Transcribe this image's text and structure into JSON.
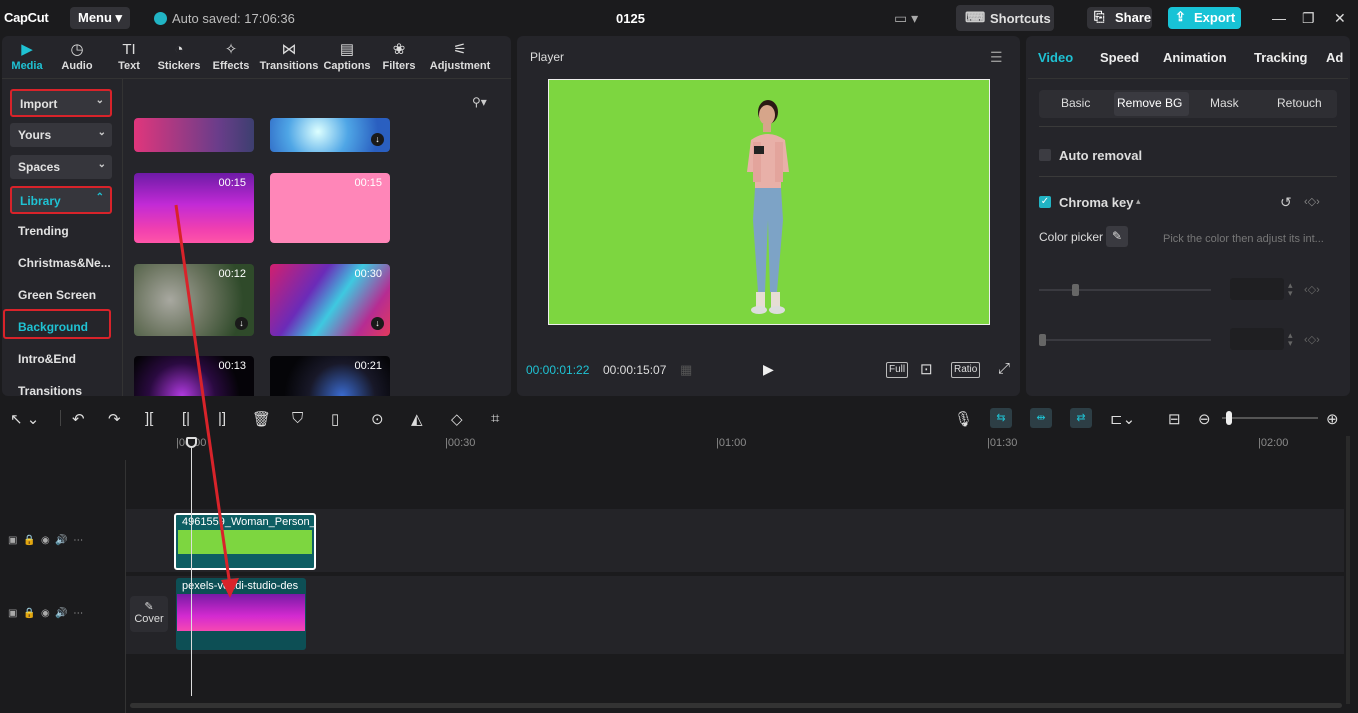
{
  "app": {
    "logo": "CapCut",
    "menu": "Menu ▾",
    "saved": "Auto saved: 17:06:36",
    "project": "0125",
    "shortcuts": "Shortcuts",
    "share": "Share",
    "export": "Export"
  },
  "tabs": [
    {
      "label": "Media",
      "icon": "▶"
    },
    {
      "label": "Audio",
      "icon": "◷"
    },
    {
      "label": "Text",
      "icon": "TI"
    },
    {
      "label": "Stickers",
      "icon": "◔"
    },
    {
      "label": "Effects",
      "icon": "✧"
    },
    {
      "label": "Transitions",
      "icon": "⋈"
    },
    {
      "label": "Captions",
      "icon": "▤"
    },
    {
      "label": "Filters",
      "icon": "❀"
    },
    {
      "label": "Adjustment",
      "icon": "⚟"
    }
  ],
  "sidebar": [
    {
      "label": "Import"
    },
    {
      "label": "Yours"
    },
    {
      "label": "Spaces"
    },
    {
      "label": "Library"
    },
    {
      "label": "Trending"
    },
    {
      "label": "Christmas&Ne..."
    },
    {
      "label": "Green Screen"
    },
    {
      "label": "Background"
    },
    {
      "label": "Intro&End"
    },
    {
      "label": "Transitions"
    }
  ],
  "thumbs": [
    {
      "duration": ""
    },
    {
      "duration": ""
    },
    {
      "duration": "00:15"
    },
    {
      "duration": "00:15"
    },
    {
      "duration": "00:12"
    },
    {
      "duration": "00:30"
    },
    {
      "duration": "00:13"
    },
    {
      "duration": "00:21"
    }
  ],
  "player": {
    "title": "Player",
    "current": "00:00:01:22",
    "total": "00:00:15:07",
    "full": "Full",
    "ratio": "Ratio"
  },
  "right": {
    "tabs": [
      "Video",
      "Speed",
      "Animation",
      "Tracking",
      "Ad"
    ],
    "segments": [
      "Basic",
      "Remove BG",
      "Mask",
      "Retouch"
    ],
    "auto_removal": "Auto removal",
    "chroma_key": "Chroma key",
    "color_picker": "Color picker",
    "hint": "Pick the color then adjust its int..."
  },
  "timeline": {
    "ruler": [
      "|00:00",
      "|00:30",
      "|01:00",
      "|01:30",
      "|02:00"
    ],
    "clip1": "4961559_Woman_Person_",
    "clip2": "pexels-vendi-studio-des",
    "cover": "Cover"
  },
  "colors": {
    "accent": "#1fc2d3",
    "annotation": "#d8232a",
    "greenscreen": "#7dd640"
  }
}
